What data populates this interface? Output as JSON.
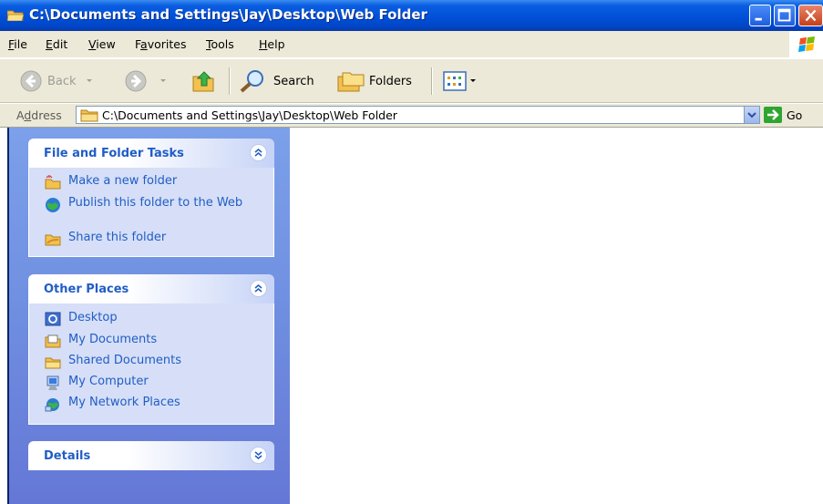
{
  "window": {
    "title": "C:\\Documents and Settings\\Jay\\Desktop\\Web Folder"
  },
  "menu": [
    {
      "pre": "",
      "u": "F",
      "post": "ile"
    },
    {
      "pre": "",
      "u": "E",
      "post": "dit"
    },
    {
      "pre": "",
      "u": "V",
      "post": "iew"
    },
    {
      "pre": "F",
      "u": "a",
      "post": "vorites"
    },
    {
      "pre": "",
      "u": "T",
      "post": "ools"
    },
    {
      "pre": "",
      "u": "H",
      "post": "elp"
    }
  ],
  "toolbar": {
    "back_label": "Back",
    "search_label": "Search",
    "folders_label": "Folders"
  },
  "address": {
    "label_pre": "A",
    "label_u": "d",
    "label_post": "dress",
    "value": "C:\\Documents and Settings\\Jay\\Desktop\\Web Folder",
    "go_label": "Go"
  },
  "tasks_panel": {
    "title": "File and Folder Tasks",
    "items": [
      {
        "label": "Make a new folder",
        "icon": "new-folder-icon"
      },
      {
        "label": "Publish this folder to the Web",
        "icon": "publish-web-icon"
      },
      {
        "label": "Share this folder",
        "icon": "share-folder-icon"
      }
    ]
  },
  "places_panel": {
    "title": "Other Places",
    "items": [
      {
        "label": "Desktop",
        "icon": "desktop-icon"
      },
      {
        "label": "My Documents",
        "icon": "my-documents-icon"
      },
      {
        "label": "Shared Documents",
        "icon": "shared-documents-icon"
      },
      {
        "label": "My Computer",
        "icon": "my-computer-icon"
      },
      {
        "label": "My Network Places",
        "icon": "network-places-icon"
      }
    ]
  },
  "details_panel": {
    "title": "Details"
  },
  "colors": {
    "titlebar": "#0050d8",
    "taskpane": "#6f8ee0",
    "link": "#215dc6",
    "chrome": "#ece9d8"
  }
}
